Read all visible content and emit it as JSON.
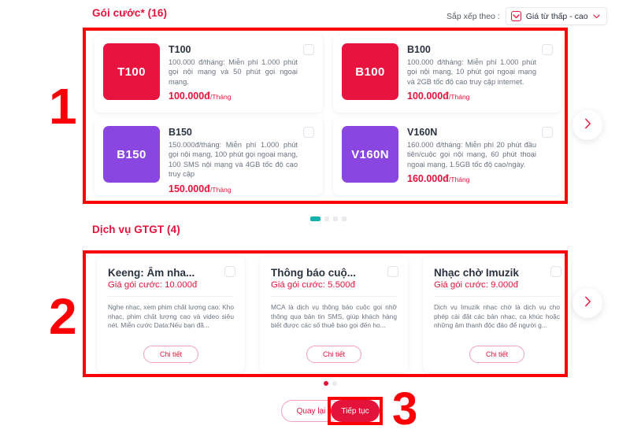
{
  "packages_section": {
    "title": "Gói cước* (16)",
    "sort": {
      "label": "Sắp xếp theo :",
      "value": "Giá từ thấp - cao",
      "icon": "sort-box-icon",
      "caret_icon": "chevron-down-icon"
    },
    "next_arrow_icon": "chevron-right-icon",
    "cards": [
      {
        "thumb_label": "T100",
        "thumb_color": "#e8133f",
        "name": "T100",
        "desc": "100.000 đ/tháng: Miễn phí 1.000 phút gọi nội mạng và 50 phút gọi ngoại mạng.",
        "price": "100.000đ",
        "price_unit": "/Tháng"
      },
      {
        "thumb_label": "B100",
        "thumb_color": "#e8133f",
        "name": "B100",
        "desc": "100.000 đ/tháng: Miễn phí 1.000 phút gọi nội mạng, 10 phút gọi ngoại mạng và 2GB tốc độ cao truy cập internet.",
        "price": "100.000đ",
        "price_unit": "/Tháng"
      },
      {
        "thumb_label": "B150",
        "thumb_color": "#8a46e0",
        "name": "B150",
        "desc": "150.000đ/tháng: Miễn phí 1.000 phút gọi nội mạng, 100 phút gọi ngoại mạng, 100 SMS nội mạng và 4GB tốc độ cao truy cập",
        "price": "150.000đ",
        "price_unit": "/Tháng"
      },
      {
        "thumb_label": "V160N",
        "thumb_color": "#8a46e0",
        "name": "V160N",
        "desc": "160.000 đ/tháng: Miễn phí 20 phút đầu tiên/cuộc gọi nội mạng, 60 phút thoại ngoại mạng, 1.5GB tốc độ cao/ngày.",
        "price": "160.000đ",
        "price_unit": "/Tháng"
      }
    ],
    "dots": [
      {
        "active": true,
        "color": "#14b1ab"
      },
      {
        "active": false,
        "color": "#e8eaee"
      },
      {
        "active": false,
        "color": "#e8eaee"
      },
      {
        "active": false,
        "color": "#e8eaee"
      }
    ]
  },
  "services_section": {
    "title": "Dịch vụ GTGT (4)",
    "next_arrow_icon": "chevron-right-icon",
    "cards": [
      {
        "name": "Keeng: Âm nha...",
        "price": "Giá gói cước: 10.000đ",
        "desc": "Nghe nhạc, xem phim chất lượng cao: Kho nhạc, phim chất lượng cao và video siêu nét. Miễn cước Data:Nếu bạn đã...",
        "button": "Chi tiết"
      },
      {
        "name": "Thông báo cuộ...",
        "price": "Giá gói cước: 5.500đ",
        "desc": "MCA là dịch vụ thông báo cuộc gọi nhỡ thông qua bản tin SMS, giúp khách hàng biết được các số thuê bao gọi đến ho...",
        "button": "Chi tiết"
      },
      {
        "name": "Nhạc chờ Imuzik",
        "price": "Giá gói cước: 9.000đ",
        "desc": "Dịch vụ Imuzik nhạc chờ là dịch vụ cho phép cài đặt các bản nhạc, ca khúc hoặc những âm thanh độc đáo để người g...",
        "button": "Chi tiết"
      }
    ],
    "dots": [
      {
        "active": true,
        "color": "#e3133c"
      },
      {
        "active": false,
        "color": "#e8eaee"
      }
    ]
  },
  "footer": {
    "back_button": "Quay lại",
    "continue_button": "Tiếp tục"
  },
  "annotations": {
    "color": "#fb0007",
    "markers": [
      {
        "number": "1"
      },
      {
        "number": "2"
      },
      {
        "number": "3"
      }
    ]
  }
}
